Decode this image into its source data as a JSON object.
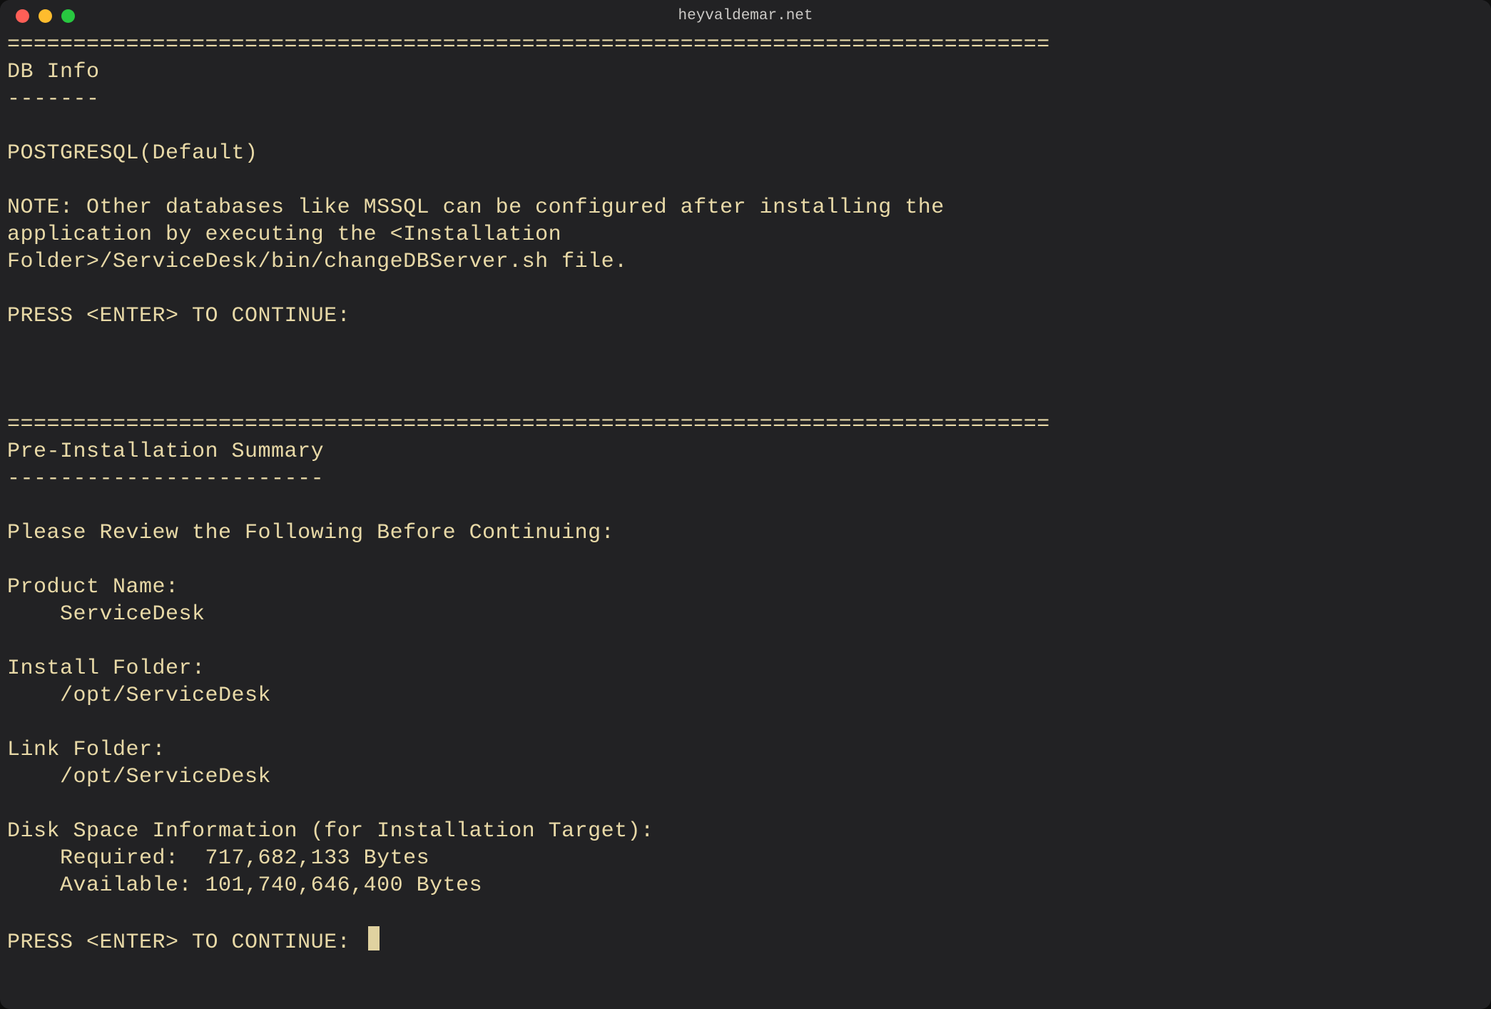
{
  "window": {
    "title": "heyvaldemar.net"
  },
  "sep": "===============================================================================",
  "db_info": {
    "heading": "DB Info",
    "rule": "-------",
    "db": "POSTGRESQL(Default)",
    "note_l1": "NOTE: Other databases like MSSQL can be configured after installing the",
    "note_l2": "application by executing the <Installation",
    "note_l3": "Folder>/ServiceDesk/bin/changeDBServer.sh file.",
    "prompt": "PRESS <ENTER> TO CONTINUE: "
  },
  "pre_install": {
    "heading": "Pre-Installation Summary",
    "rule": "------------------------",
    "intro": "Please Review the Following Before Continuing:",
    "product_name_label": "Product Name:",
    "product_name_value": "    ServiceDesk",
    "install_folder_label": "Install Folder:",
    "install_folder_value": "    /opt/ServiceDesk",
    "link_folder_label": "Link Folder:",
    "link_folder_value": "    /opt/ServiceDesk",
    "disk_header": "Disk Space Information (for Installation Target):",
    "disk_required": "    Required:  717,682,133 Bytes",
    "disk_available": "    Available: 101,740,646,400 Bytes",
    "prompt": "PRESS <ENTER> TO CONTINUE: "
  }
}
